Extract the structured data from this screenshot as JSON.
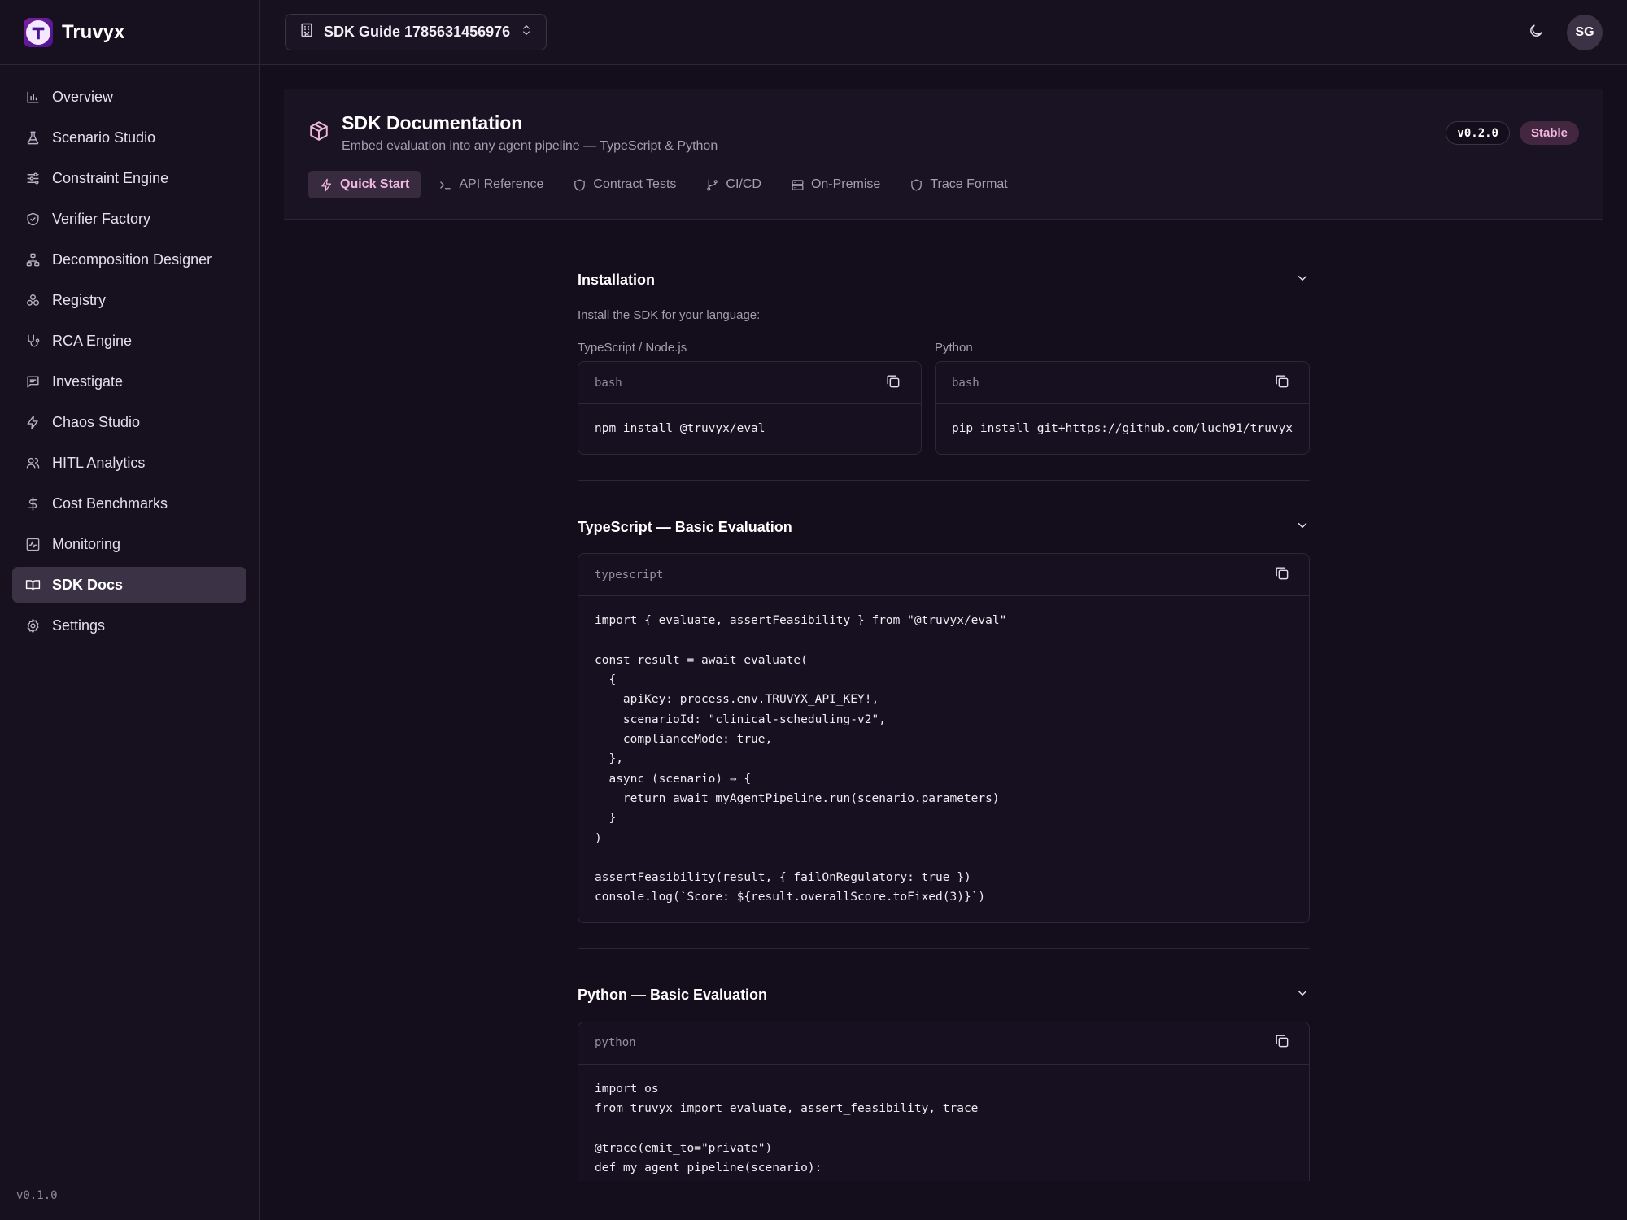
{
  "brand": {
    "name": "Truvyx"
  },
  "sidebar": {
    "items": [
      {
        "label": "Overview",
        "icon": "bar-chart-icon"
      },
      {
        "label": "Scenario Studio",
        "icon": "flask-icon"
      },
      {
        "label": "Constraint Engine",
        "icon": "sliders-icon"
      },
      {
        "label": "Verifier Factory",
        "icon": "shield-check-icon"
      },
      {
        "label": "Decomposition Designer",
        "icon": "network-icon"
      },
      {
        "label": "Registry",
        "icon": "boxes-icon"
      },
      {
        "label": "RCA Engine",
        "icon": "stethoscope-icon"
      },
      {
        "label": "Investigate",
        "icon": "message-square-icon"
      },
      {
        "label": "Chaos Studio",
        "icon": "zap-icon"
      },
      {
        "label": "HITL Analytics",
        "icon": "users-icon"
      },
      {
        "label": "Cost Benchmarks",
        "icon": "dollar-icon"
      },
      {
        "label": "Monitoring",
        "icon": "activity-icon"
      },
      {
        "label": "SDK Docs",
        "icon": "book-open-icon",
        "active": true
      },
      {
        "label": "Settings",
        "icon": "gear-icon"
      }
    ],
    "version": "v0.1.0"
  },
  "topbar": {
    "workspace": "SDK Guide 1785631456976",
    "avatar_initials": "SG"
  },
  "page": {
    "title": "SDK Documentation",
    "subtitle": "Embed evaluation into any agent pipeline — TypeScript & Python",
    "version_badge": "v0.2.0",
    "status_badge": "Stable",
    "tabs": [
      {
        "label": "Quick Start",
        "icon": "zap-icon",
        "active": true
      },
      {
        "label": "API Reference",
        "icon": "terminal-icon"
      },
      {
        "label": "Contract Tests",
        "icon": "shield-icon"
      },
      {
        "label": "CI/CD",
        "icon": "git-branch-icon"
      },
      {
        "label": "On-Premise",
        "icon": "server-icon"
      },
      {
        "label": "Trace Format",
        "icon": "shield-icon"
      }
    ]
  },
  "sections": {
    "installation": {
      "title": "Installation",
      "description": "Install the SDK for your language:",
      "ts_label": "TypeScript / Node.js",
      "ts_lang": "bash",
      "ts_code": "npm install @truvyx/eval",
      "py_label": "Python",
      "py_lang": "bash",
      "py_code": "pip install git+https://github.com/luch91/truvyx"
    },
    "ts_basic": {
      "title": "TypeScript — Basic Evaluation",
      "lang": "typescript",
      "code": "import { evaluate, assertFeasibility } from \"@truvyx/eval\"\n\nconst result = await evaluate(\n  {\n    apiKey: process.env.TRUVYX_API_KEY!,\n    scenarioId: \"clinical-scheduling-v2\",\n    complianceMode: true,\n  },\n  async (scenario) ⇒ {\n    return await myAgentPipeline.run(scenario.parameters)\n  }\n)\n\nassertFeasibility(result, { failOnRegulatory: true })\nconsole.log(`Score: ${result.overallScore.toFixed(3)}`)"
    },
    "py_basic": {
      "title": "Python — Basic Evaluation",
      "lang": "python",
      "code": "import os\nfrom truvyx import evaluate, assert_feasibility, trace\n\n@trace(emit_to=\"private\")\ndef my_agent_pipeline(scenario):"
    }
  }
}
